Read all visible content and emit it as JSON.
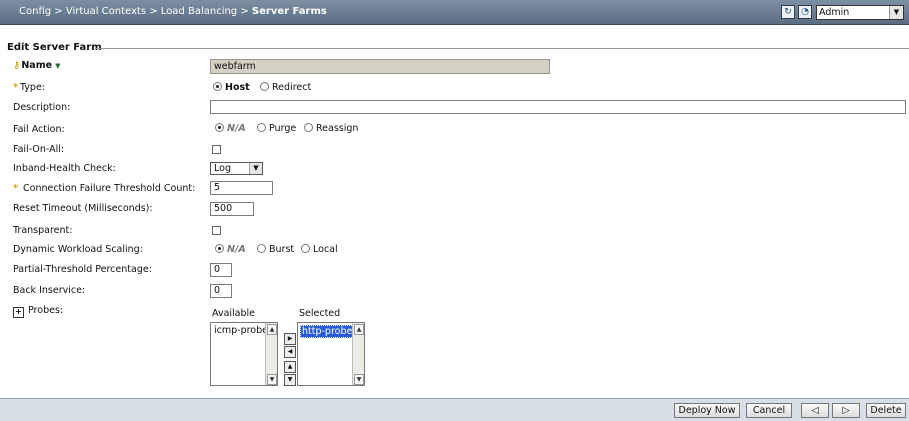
{
  "breadcrumb": {
    "parts": "Config > Virtual Contexts > Load Balancing > ",
    "current": "Server Farms"
  },
  "toolbar": {
    "refresh_icon": "refresh-icon",
    "history_icon": "history-icon",
    "user_select": "Admin"
  },
  "section": {
    "title": "Edit Server Farm"
  },
  "fields": {
    "name": {
      "label": "Name",
      "value": "webfarm"
    },
    "type": {
      "label": "Type:",
      "options": [
        "Host",
        "Redirect"
      ],
      "selected": "Host"
    },
    "description": {
      "label": "Description:",
      "value": ""
    },
    "fail_action": {
      "label": "Fail Action:",
      "options": [
        "N/A",
        "Purge",
        "Reassign"
      ],
      "selected": "N/A"
    },
    "fail_on_all": {
      "label": "Fail-On-All:",
      "checked": false
    },
    "inband_health_check": {
      "label": "Inband-Health Check:",
      "value": "Log"
    },
    "conn_fail_threshold": {
      "label": "Connection Failure Threshold Count:",
      "value": "5"
    },
    "reset_timeout": {
      "label": "Reset Timeout (Milliseconds):",
      "value": "500"
    },
    "transparent": {
      "label": "Transparent:",
      "checked": false
    },
    "dws": {
      "label": "Dynamic Workload Scaling:",
      "options": [
        "N/A",
        "Burst",
        "Local"
      ],
      "selected": "N/A"
    },
    "partial_threshold": {
      "label": "Partial-Threshold Percentage:",
      "value": "0"
    },
    "back_inservice": {
      "label": "Back Inservice:",
      "value": "0"
    },
    "probes": {
      "label": "Probes:",
      "available_label": "Available",
      "selected_label": "Selected",
      "available": [
        "icmp-probe"
      ],
      "selected": [
        "http-probe"
      ]
    }
  },
  "footer": {
    "deploy": "Deploy Now",
    "cancel": "Cancel",
    "prev": "◁",
    "next": "▷",
    "delete": "Delete"
  }
}
